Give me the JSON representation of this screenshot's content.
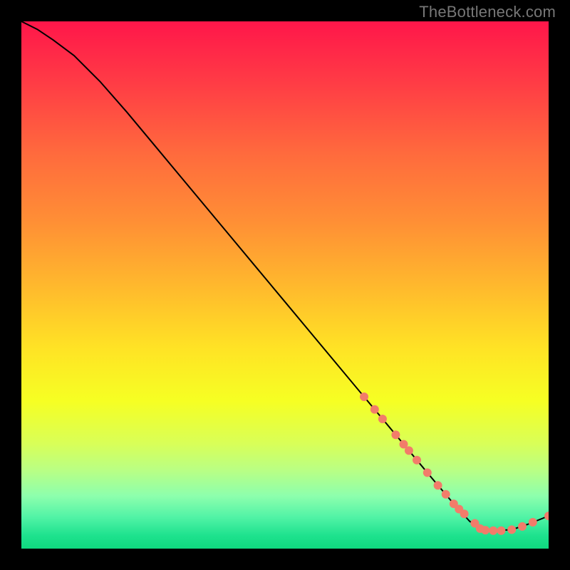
{
  "watermark": "TheBottleneck.com",
  "chart_data": {
    "type": "line",
    "title": "",
    "xlabel": "",
    "ylabel": "",
    "xlim": [
      0,
      100
    ],
    "ylim": [
      0,
      100
    ],
    "grid": false,
    "legend": false,
    "notes": "Background is a vertical rainbow gradient (red→yellow→green). A black curve descends from top-left with slight initial curvature to a minimum near x≈87 then rises to the right edge. Salmon dots mark data points along the lower-right portion of the curve.",
    "gradient_stops": [
      {
        "offset": 0.0,
        "color": "#ff164a"
      },
      {
        "offset": 0.12,
        "color": "#ff3d45"
      },
      {
        "offset": 0.25,
        "color": "#ff6a3d"
      },
      {
        "offset": 0.38,
        "color": "#ff8f35"
      },
      {
        "offset": 0.5,
        "color": "#ffb82d"
      },
      {
        "offset": 0.62,
        "color": "#ffe325"
      },
      {
        "offset": 0.72,
        "color": "#f6ff23"
      },
      {
        "offset": 0.8,
        "color": "#d9ff57"
      },
      {
        "offset": 0.85,
        "color": "#baff83"
      },
      {
        "offset": 0.9,
        "color": "#8dffad"
      },
      {
        "offset": 0.94,
        "color": "#52f3a6"
      },
      {
        "offset": 0.975,
        "color": "#1ee28e"
      },
      {
        "offset": 1.0,
        "color": "#0fd97f"
      }
    ],
    "series": [
      {
        "name": "curve",
        "type": "line",
        "color": "#000000",
        "width": 2,
        "x": [
          0,
          3,
          6,
          10,
          15,
          20,
          25,
          30,
          35,
          40,
          45,
          50,
          55,
          60,
          65,
          70,
          74,
          78,
          82,
          85,
          87,
          90,
          93,
          96,
          100
        ],
        "y": [
          100,
          98.5,
          96.5,
          93.5,
          88.5,
          82.8,
          76.8,
          70.8,
          64.8,
          58.8,
          52.8,
          46.8,
          40.8,
          34.8,
          28.8,
          22.8,
          18.0,
          13.2,
          8.5,
          5.2,
          3.8,
          3.4,
          3.6,
          4.6,
          6.2
        ]
      },
      {
        "name": "dots",
        "type": "scatter",
        "color": "#f27c6a",
        "radius": 6,
        "x": [
          65,
          67,
          68.5,
          71,
          72.5,
          73.5,
          75,
          77,
          79,
          80.5,
          82,
          83,
          84,
          86,
          87,
          88,
          89.5,
          91,
          93,
          95,
          97,
          100
        ],
        "y": [
          28.8,
          26.4,
          24.6,
          21.6,
          19.8,
          18.6,
          16.8,
          14.4,
          12.0,
          10.3,
          8.5,
          7.5,
          6.6,
          4.8,
          3.8,
          3.5,
          3.4,
          3.4,
          3.6,
          4.2,
          5.0,
          6.2
        ]
      }
    ]
  }
}
